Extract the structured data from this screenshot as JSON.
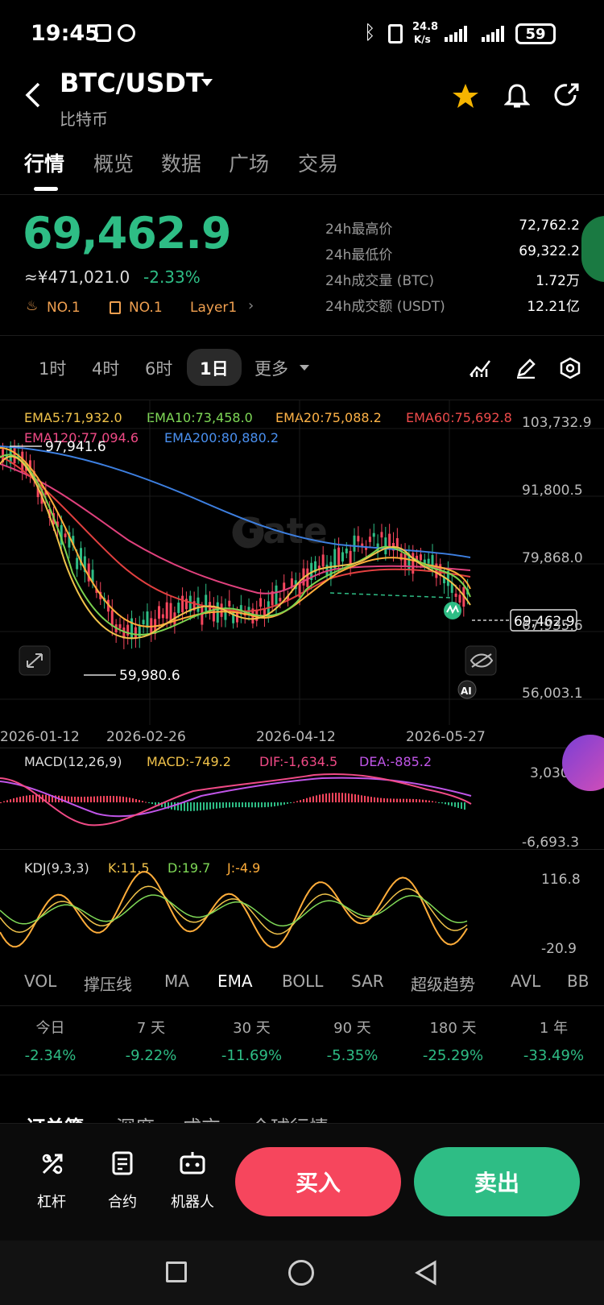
{
  "status_bar": {
    "time": "19:45",
    "net_speed_top": "24.8",
    "net_speed_bottom": "K/s",
    "battery": "59"
  },
  "header": {
    "pair": "BTC/USDT",
    "subtitle": "比特币"
  },
  "tabs": [
    {
      "label": "行情",
      "active": true
    },
    {
      "label": "概览"
    },
    {
      "label": "数据"
    },
    {
      "label": "广场"
    },
    {
      "label": "交易"
    }
  ],
  "price": {
    "last": "69,462.9",
    "cny": "≈¥471,021.0",
    "change": "-2.33%",
    "badges": [
      "NO.1",
      "NO.1",
      "Layer1"
    ]
  },
  "stats": [
    {
      "label": "24h最高价",
      "value": "72,762.2"
    },
    {
      "label": "24h最低价",
      "value": "69,322.2"
    },
    {
      "label": "24h成交量 (BTC)",
      "value": "1.72万"
    },
    {
      "label": "24h成交额 (USDT)",
      "value": "12.21亿"
    }
  ],
  "intervals": [
    "1时",
    "4时",
    "6时",
    "1日",
    "更多"
  ],
  "active_interval": "1日",
  "ema_legend": {
    "ema5": "EMA5:71,932.0",
    "ema10": "EMA10:73,458.0",
    "ema20": "EMA20:75,088.2",
    "ema60": "EMA60:75,692.8",
    "ema120": "EMA120:77,094.6",
    "ema200": "EMA200:80,880.2"
  },
  "price_axis": [
    "103,732.9",
    "91,800.5",
    "79,868.0",
    "67,935.6",
    "56,003.1"
  ],
  "chart_marks": {
    "high_label": "97,941.6",
    "low_label": "59,980.6",
    "last_label": "69,462.9",
    "watermark": "Gate",
    "ai_label": "AI"
  },
  "date_axis": [
    "2026-01-12",
    "2026-02-26",
    "2026-04-12",
    "2026-05-27"
  ],
  "macd": {
    "name": "MACD(12,26,9)",
    "macd": "MACD:-749.2",
    "dif": "DIF:-1,634.5",
    "dea": "DEA:-885.2",
    "top": "3,030.7",
    "bottom": "-6,693.3"
  },
  "kdj": {
    "name": "KDJ(9,3,3)",
    "k": "K:11.5",
    "d": "D:19.7",
    "j": "J:-4.9",
    "top": "116.8",
    "bottom": "-20.9"
  },
  "indicators": [
    "VOL",
    "撑压线",
    "MA",
    "EMA",
    "BOLL",
    "SAR",
    "超级趋势",
    "AVL",
    "BB"
  ],
  "active_indicator": "EMA",
  "periods": [
    {
      "label": "今日",
      "value": "-2.34%"
    },
    {
      "label": "7 天",
      "value": "-9.22%"
    },
    {
      "label": "30 天",
      "value": "-11.69%"
    },
    {
      "label": "90 天",
      "value": "-5.35%"
    },
    {
      "label": "180 天",
      "value": "-25.29%"
    },
    {
      "label": "1 年",
      "value": "-33.49%"
    }
  ],
  "lower_tabs": [
    "订单簿",
    "深度",
    "成交",
    "全球行情"
  ],
  "bottom_bar": {
    "leverage": "杠杆",
    "contract": "合约",
    "robot": "机器人",
    "buy": "买入",
    "sell": "卖出"
  },
  "colors": {
    "green": "#2ebd85",
    "red": "#f6465d",
    "background": "#000000"
  }
}
